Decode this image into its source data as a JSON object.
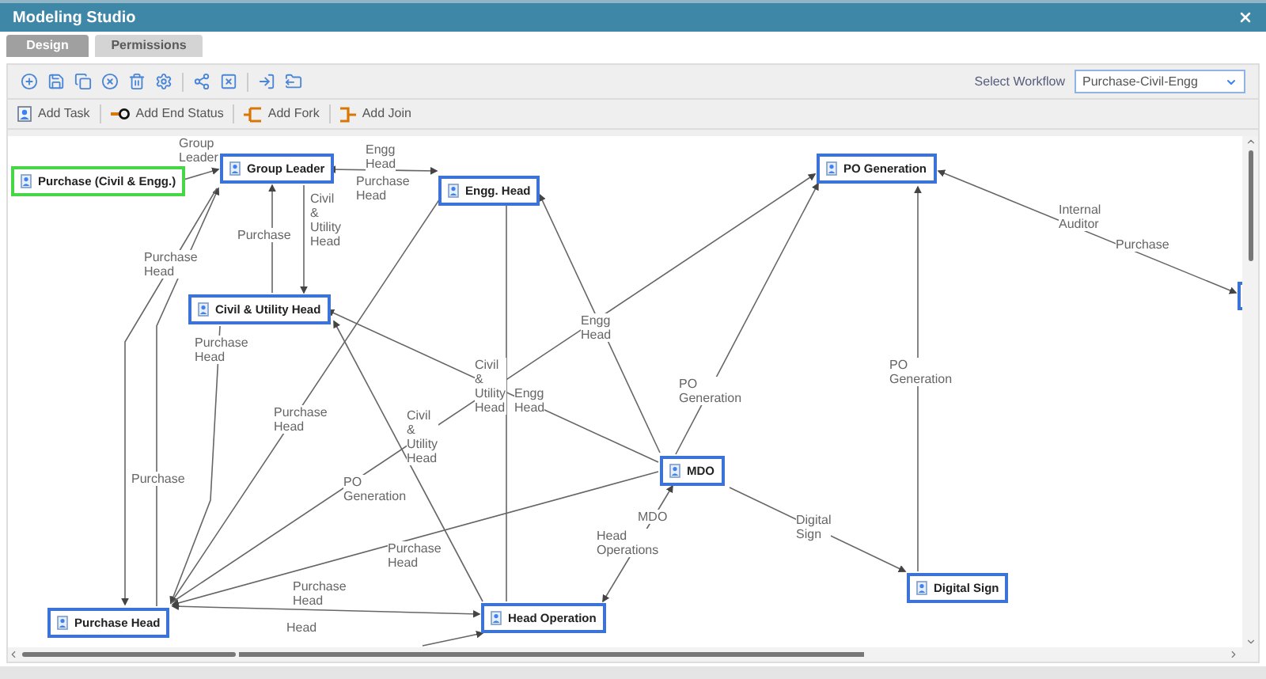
{
  "window": {
    "title": "Modeling Studio"
  },
  "tabs": [
    {
      "label": "Design",
      "selected": true
    },
    {
      "label": "Permissions",
      "selected": false
    }
  ],
  "workflow": {
    "label": "Select Workflow",
    "value": "Purchase-Civil-Engg"
  },
  "actions": [
    {
      "label": "Add Task",
      "kind": "task"
    },
    {
      "label": "Add End Status",
      "kind": "end"
    },
    {
      "label": "Add Fork",
      "kind": "fork"
    },
    {
      "label": "Add Join",
      "kind": "join"
    }
  ],
  "diagram": {
    "nodes": [
      {
        "label": "Purchase (Civil & Engg.)",
        "kind": "start"
      },
      {
        "label": "Group Leader",
        "kind": "task"
      },
      {
        "label": "Engg. Head",
        "kind": "task"
      },
      {
        "label": "Civil & Utility Head",
        "kind": "task"
      },
      {
        "label": "PO Generation",
        "kind": "task"
      },
      {
        "label": "MDO",
        "kind": "task"
      },
      {
        "label": "Head Operation",
        "kind": "task"
      },
      {
        "label": "Digital Sign",
        "kind": "task"
      },
      {
        "label": "Purchase Head",
        "kind": "task"
      },
      {
        "kind": "partial"
      }
    ],
    "edges": [
      {
        "labels": [
          "Group Leader"
        ]
      },
      {
        "labels": [
          "Engg Head",
          "Purchase Head"
        ]
      },
      {
        "labels": [
          "Civil & Utility Head"
        ]
      },
      {
        "labels": [
          "Purchase"
        ]
      },
      {
        "labels": [
          "Purchase Head"
        ]
      },
      {
        "labels": [
          "Purchase"
        ]
      },
      {
        "labels": [
          "Purchase Head"
        ]
      },
      {
        "labels": [
          "Purchase Head"
        ]
      },
      {
        "labels": [
          "Engg Head"
        ]
      },
      {
        "labels": [
          "Civil & Utility Head"
        ]
      },
      {
        "labels": [
          "Engg Head"
        ]
      },
      {
        "labels": [
          "PO Generation"
        ]
      },
      {
        "labels": [
          "PO Generation"
        ]
      },
      {
        "labels": [
          "Civil & Utility Head"
        ]
      },
      {
        "labels": [
          "Purchase Head"
        ]
      },
      {
        "labels": [
          "Head Operations",
          "MDO"
        ]
      },
      {
        "labels": [
          "Digital Sign"
        ]
      },
      {
        "labels": [
          "PO Generation"
        ]
      },
      {
        "labels": [
          "Internal Auditor",
          "Purchase"
        ]
      },
      {
        "labels": [
          "Purchase Head"
        ]
      },
      {
        "labels": [
          "Head"
        ]
      }
    ]
  }
}
